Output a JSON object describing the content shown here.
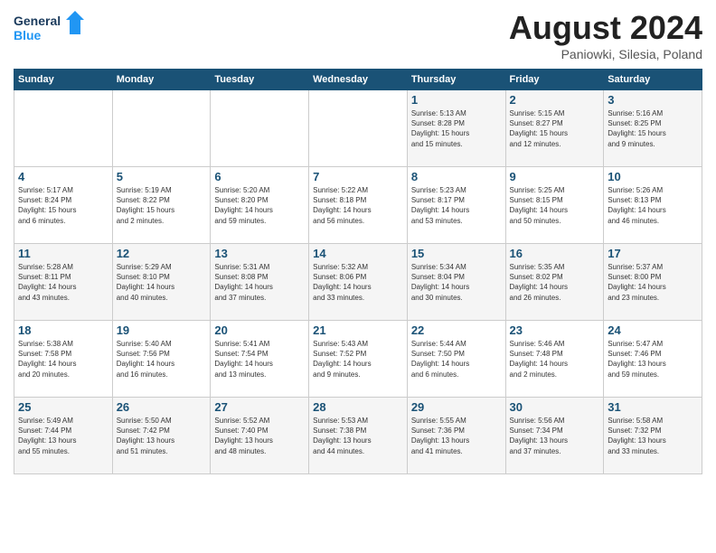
{
  "header": {
    "logo_general": "General",
    "logo_blue": "Blue",
    "month_year": "August 2024",
    "location": "Paniowki, Silesia, Poland"
  },
  "weekdays": [
    "Sunday",
    "Monday",
    "Tuesday",
    "Wednesday",
    "Thursday",
    "Friday",
    "Saturday"
  ],
  "weeks": [
    [
      {
        "day": "",
        "info": ""
      },
      {
        "day": "",
        "info": ""
      },
      {
        "day": "",
        "info": ""
      },
      {
        "day": "",
        "info": ""
      },
      {
        "day": "1",
        "info": "Sunrise: 5:13 AM\nSunset: 8:28 PM\nDaylight: 15 hours\nand 15 minutes."
      },
      {
        "day": "2",
        "info": "Sunrise: 5:15 AM\nSunset: 8:27 PM\nDaylight: 15 hours\nand 12 minutes."
      },
      {
        "day": "3",
        "info": "Sunrise: 5:16 AM\nSunset: 8:25 PM\nDaylight: 15 hours\nand 9 minutes."
      }
    ],
    [
      {
        "day": "4",
        "info": "Sunrise: 5:17 AM\nSunset: 8:24 PM\nDaylight: 15 hours\nand 6 minutes."
      },
      {
        "day": "5",
        "info": "Sunrise: 5:19 AM\nSunset: 8:22 PM\nDaylight: 15 hours\nand 2 minutes."
      },
      {
        "day": "6",
        "info": "Sunrise: 5:20 AM\nSunset: 8:20 PM\nDaylight: 14 hours\nand 59 minutes."
      },
      {
        "day": "7",
        "info": "Sunrise: 5:22 AM\nSunset: 8:18 PM\nDaylight: 14 hours\nand 56 minutes."
      },
      {
        "day": "8",
        "info": "Sunrise: 5:23 AM\nSunset: 8:17 PM\nDaylight: 14 hours\nand 53 minutes."
      },
      {
        "day": "9",
        "info": "Sunrise: 5:25 AM\nSunset: 8:15 PM\nDaylight: 14 hours\nand 50 minutes."
      },
      {
        "day": "10",
        "info": "Sunrise: 5:26 AM\nSunset: 8:13 PM\nDaylight: 14 hours\nand 46 minutes."
      }
    ],
    [
      {
        "day": "11",
        "info": "Sunrise: 5:28 AM\nSunset: 8:11 PM\nDaylight: 14 hours\nand 43 minutes."
      },
      {
        "day": "12",
        "info": "Sunrise: 5:29 AM\nSunset: 8:10 PM\nDaylight: 14 hours\nand 40 minutes."
      },
      {
        "day": "13",
        "info": "Sunrise: 5:31 AM\nSunset: 8:08 PM\nDaylight: 14 hours\nand 37 minutes."
      },
      {
        "day": "14",
        "info": "Sunrise: 5:32 AM\nSunset: 8:06 PM\nDaylight: 14 hours\nand 33 minutes."
      },
      {
        "day": "15",
        "info": "Sunrise: 5:34 AM\nSunset: 8:04 PM\nDaylight: 14 hours\nand 30 minutes."
      },
      {
        "day": "16",
        "info": "Sunrise: 5:35 AM\nSunset: 8:02 PM\nDaylight: 14 hours\nand 26 minutes."
      },
      {
        "day": "17",
        "info": "Sunrise: 5:37 AM\nSunset: 8:00 PM\nDaylight: 14 hours\nand 23 minutes."
      }
    ],
    [
      {
        "day": "18",
        "info": "Sunrise: 5:38 AM\nSunset: 7:58 PM\nDaylight: 14 hours\nand 20 minutes."
      },
      {
        "day": "19",
        "info": "Sunrise: 5:40 AM\nSunset: 7:56 PM\nDaylight: 14 hours\nand 16 minutes."
      },
      {
        "day": "20",
        "info": "Sunrise: 5:41 AM\nSunset: 7:54 PM\nDaylight: 14 hours\nand 13 minutes."
      },
      {
        "day": "21",
        "info": "Sunrise: 5:43 AM\nSunset: 7:52 PM\nDaylight: 14 hours\nand 9 minutes."
      },
      {
        "day": "22",
        "info": "Sunrise: 5:44 AM\nSunset: 7:50 PM\nDaylight: 14 hours\nand 6 minutes."
      },
      {
        "day": "23",
        "info": "Sunrise: 5:46 AM\nSunset: 7:48 PM\nDaylight: 14 hours\nand 2 minutes."
      },
      {
        "day": "24",
        "info": "Sunrise: 5:47 AM\nSunset: 7:46 PM\nDaylight: 13 hours\nand 59 minutes."
      }
    ],
    [
      {
        "day": "25",
        "info": "Sunrise: 5:49 AM\nSunset: 7:44 PM\nDaylight: 13 hours\nand 55 minutes."
      },
      {
        "day": "26",
        "info": "Sunrise: 5:50 AM\nSunset: 7:42 PM\nDaylight: 13 hours\nand 51 minutes."
      },
      {
        "day": "27",
        "info": "Sunrise: 5:52 AM\nSunset: 7:40 PM\nDaylight: 13 hours\nand 48 minutes."
      },
      {
        "day": "28",
        "info": "Sunrise: 5:53 AM\nSunset: 7:38 PM\nDaylight: 13 hours\nand 44 minutes."
      },
      {
        "day": "29",
        "info": "Sunrise: 5:55 AM\nSunset: 7:36 PM\nDaylight: 13 hours\nand 41 minutes."
      },
      {
        "day": "30",
        "info": "Sunrise: 5:56 AM\nSunset: 7:34 PM\nDaylight: 13 hours\nand 37 minutes."
      },
      {
        "day": "31",
        "info": "Sunrise: 5:58 AM\nSunset: 7:32 PM\nDaylight: 13 hours\nand 33 minutes."
      }
    ]
  ]
}
